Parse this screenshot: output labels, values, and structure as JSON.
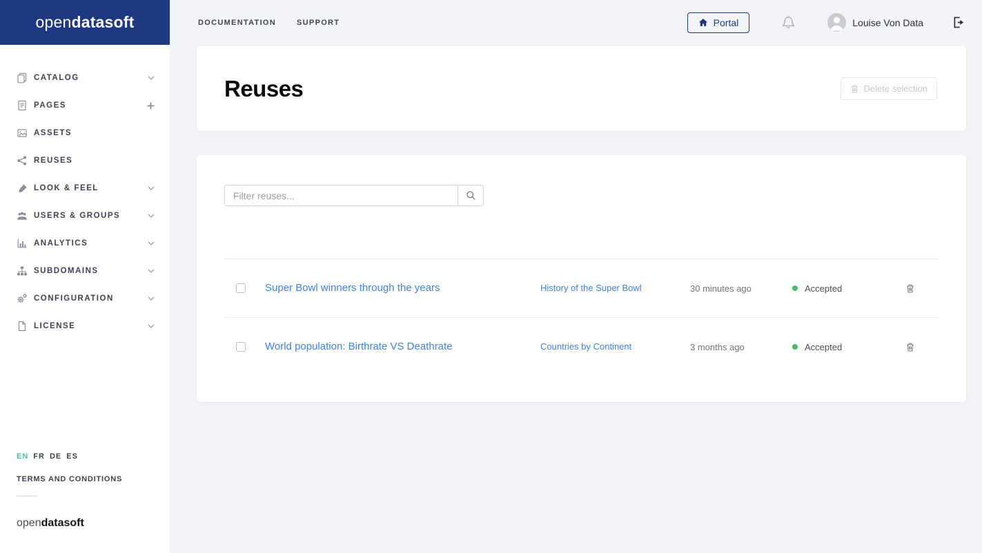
{
  "brand": {
    "open": "open",
    "data": "data",
    "soft": "soft"
  },
  "topbar": {
    "nav": [
      {
        "label": "DOCUMENTATION"
      },
      {
        "label": "SUPPORT"
      }
    ],
    "portal_label": "Portal",
    "user_name": "Louise Von Data",
    "icons": [
      "home-icon",
      "bell-icon",
      "avatar-person-icon",
      "sign-out-icon"
    ]
  },
  "sidebar": {
    "items": [
      {
        "label": "CATALOG",
        "icon": "catalog-icon",
        "accessory": "chevron-down"
      },
      {
        "label": "PAGES",
        "icon": "pages-icon",
        "accessory": "plus"
      },
      {
        "label": "ASSETS",
        "icon": "assets-icon",
        "accessory": "none"
      },
      {
        "label": "REUSES",
        "icon": "reuses-share-icon",
        "accessory": "none"
      },
      {
        "label": "LOOK & FEEL",
        "icon": "paintbrush-icon",
        "accessory": "chevron-down"
      },
      {
        "label": "USERS & GROUPS",
        "icon": "users-icon",
        "accessory": "chevron-down"
      },
      {
        "label": "ANALYTICS",
        "icon": "bar-chart-icon",
        "accessory": "chevron-down"
      },
      {
        "label": "SUBDOMAINS",
        "icon": "sitemap-icon",
        "accessory": "chevron-down"
      },
      {
        "label": "CONFIGURATION",
        "icon": "gears-icon",
        "accessory": "chevron-down"
      },
      {
        "label": "LICENSE",
        "icon": "license-file-icon",
        "accessory": "chevron-down"
      }
    ],
    "languages": [
      "EN",
      "FR",
      "DE",
      "ES"
    ],
    "active_language": "EN",
    "terms_label": "TERMS AND CONDITIONS"
  },
  "main": {
    "title": "Reuses",
    "delete_selection_label": "Delete selection",
    "filter_placeholder": "Filter reuses...",
    "rows": [
      {
        "title": "Super Bowl winners through the years",
        "dataset": "History of the Super Bowl",
        "time": "30 minutes ago",
        "status": "Accepted"
      },
      {
        "title": "World population: Birthrate VS Deathrate",
        "dataset": "Countries by Continent",
        "time": "3 months ago",
        "status": "Accepted"
      }
    ]
  },
  "colors": {
    "navy": "#1d3880",
    "link_blue": "#4183d7",
    "status_green": "#4cb86a",
    "active_language_teal": "#43c1a8",
    "page_background": "#f3f4f7"
  }
}
